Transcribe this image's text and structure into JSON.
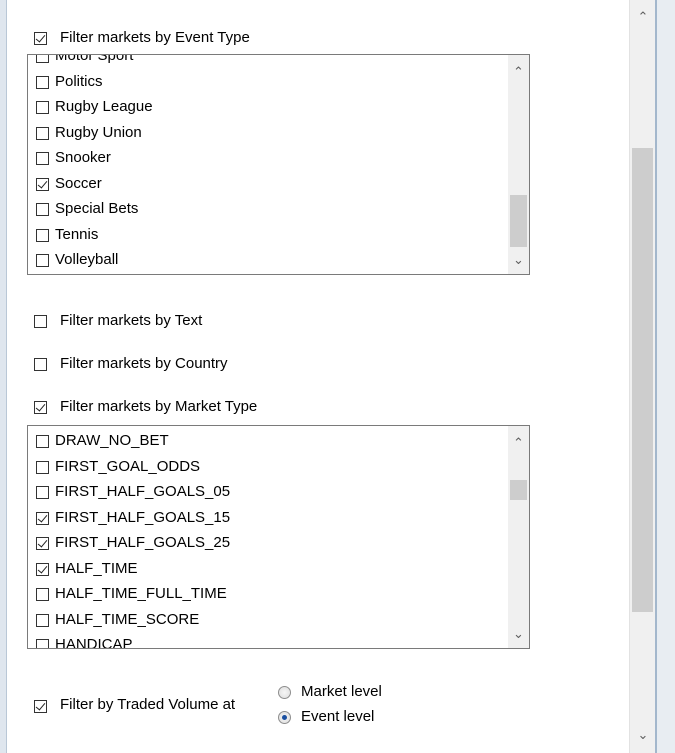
{
  "filters": {
    "event_type": {
      "label": "Filter markets by Event Type",
      "checked": true
    },
    "text": {
      "label": "Filter markets by Text",
      "checked": false
    },
    "country": {
      "label": "Filter markets by Country",
      "checked": false
    },
    "market_type": {
      "label": "Filter markets by Market Type",
      "checked": true
    },
    "traded_volume": {
      "label": "Filter by Traded Volume at",
      "checked": true
    }
  },
  "event_types": [
    {
      "label": "Motor Sport",
      "checked": false
    },
    {
      "label": "Politics",
      "checked": false
    },
    {
      "label": "Rugby League",
      "checked": false
    },
    {
      "label": "Rugby Union",
      "checked": false
    },
    {
      "label": "Snooker",
      "checked": false
    },
    {
      "label": "Soccer",
      "checked": true
    },
    {
      "label": "Special Bets",
      "checked": false
    },
    {
      "label": "Tennis",
      "checked": false
    },
    {
      "label": "Volleyball",
      "checked": false
    }
  ],
  "market_types": [
    {
      "label": "DRAW_NO_BET",
      "checked": false
    },
    {
      "label": "FIRST_GOAL_ODDS",
      "checked": false
    },
    {
      "label": "FIRST_HALF_GOALS_05",
      "checked": false
    },
    {
      "label": "FIRST_HALF_GOALS_15",
      "checked": true
    },
    {
      "label": "FIRST_HALF_GOALS_25",
      "checked": true
    },
    {
      "label": "HALF_TIME",
      "checked": true
    },
    {
      "label": "HALF_TIME_FULL_TIME",
      "checked": false
    },
    {
      "label": "HALF_TIME_SCORE",
      "checked": false
    },
    {
      "label": "HANDICAP",
      "checked": false
    }
  ],
  "volume_level": {
    "options": [
      {
        "label": "Market level",
        "selected": false
      },
      {
        "label": "Event level",
        "selected": true
      }
    ]
  },
  "icons": {
    "up": "chevron-up-icon",
    "down": "chevron-down-icon"
  }
}
